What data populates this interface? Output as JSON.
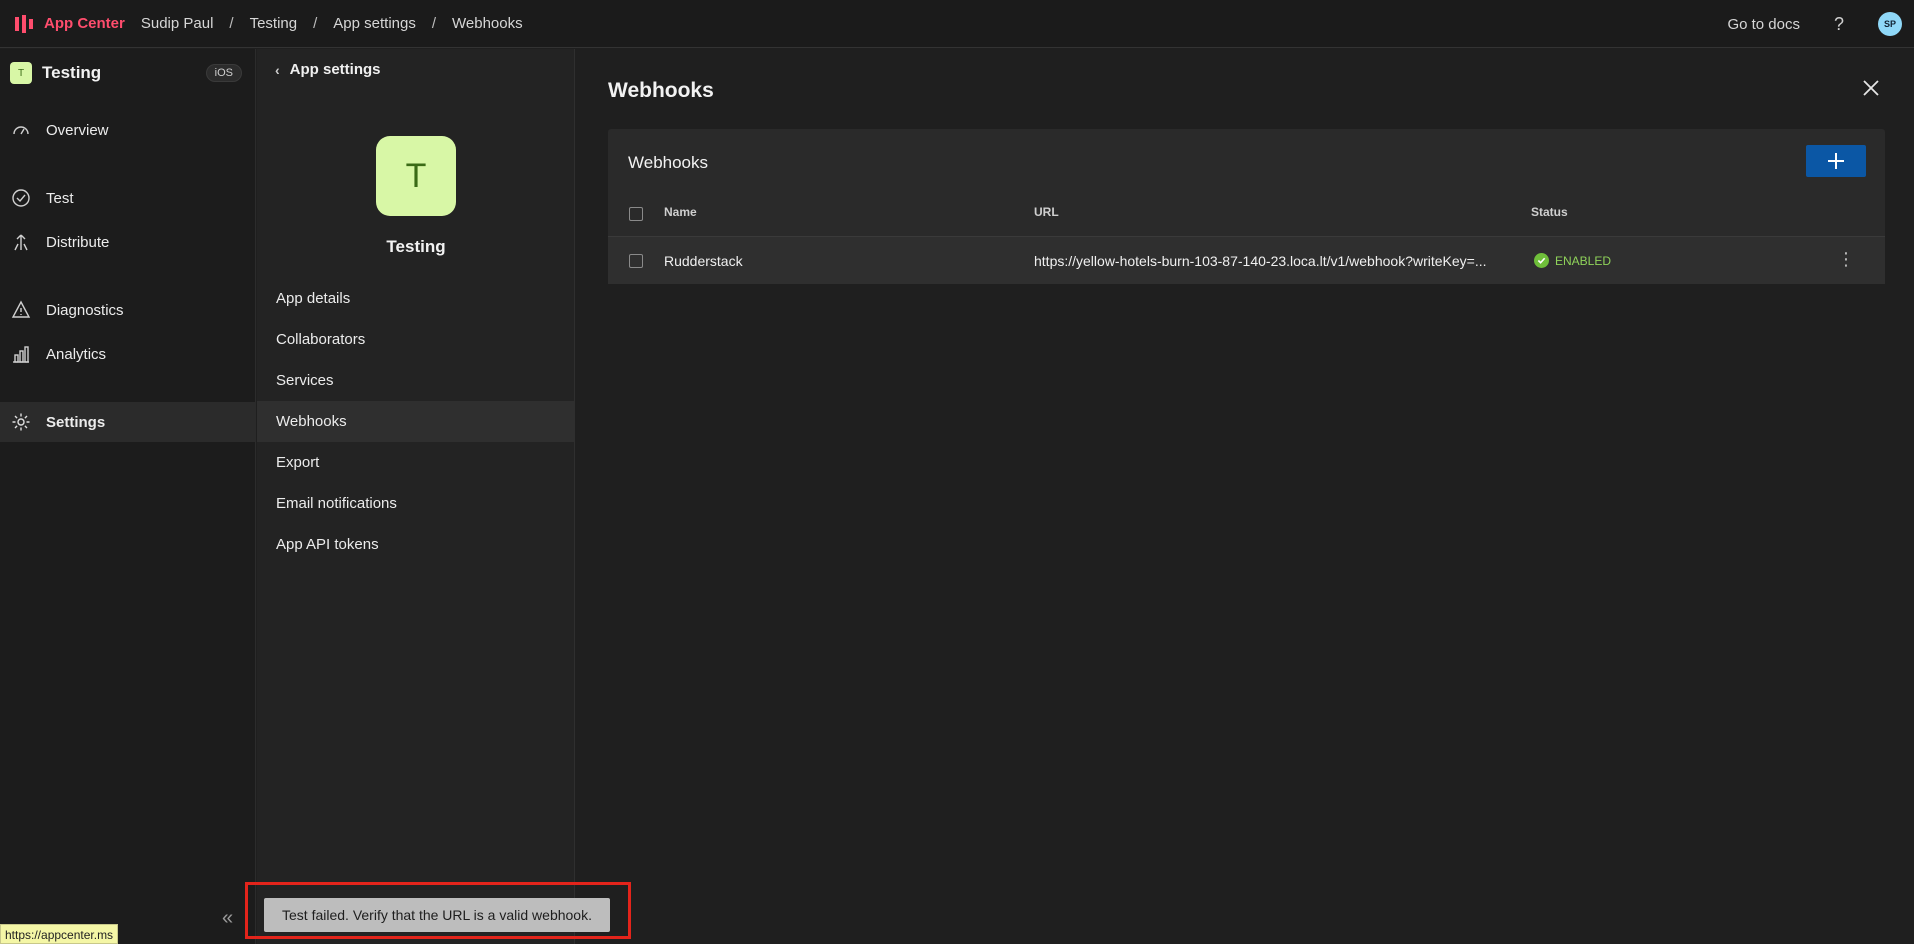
{
  "header": {
    "brand": "App Center",
    "breadcrumbs": [
      "Sudip Paul",
      "Testing",
      "App settings",
      "Webhooks"
    ],
    "docs_link": "Go to docs",
    "help": "?",
    "avatar_initials": "SP"
  },
  "left_nav": {
    "app_badge": "T",
    "app_name": "Testing",
    "platform": "iOS",
    "items": [
      {
        "label": "Overview",
        "icon": "gauge-icon"
      },
      {
        "label": "Test",
        "icon": "check-circle-icon"
      },
      {
        "label": "Distribute",
        "icon": "distribute-icon"
      },
      {
        "label": "Diagnostics",
        "icon": "warning-icon"
      },
      {
        "label": "Analytics",
        "icon": "bar-chart-icon"
      },
      {
        "label": "Settings",
        "icon": "gear-icon",
        "active": true
      }
    ],
    "collapse_icon": "double-chevron-left-icon"
  },
  "sub_nav": {
    "back_label": "App settings",
    "app_badge": "T",
    "app_name": "Testing",
    "items": [
      {
        "label": "App details"
      },
      {
        "label": "Collaborators"
      },
      {
        "label": "Services"
      },
      {
        "label": "Webhooks",
        "active": true
      },
      {
        "label": "Export"
      },
      {
        "label": "Email notifications"
      },
      {
        "label": "App API tokens"
      }
    ]
  },
  "main": {
    "title": "Webhooks",
    "card_title": "Webhooks",
    "columns": [
      "Name",
      "URL",
      "Status"
    ],
    "rows": [
      {
        "name": "Rudderstack",
        "url": "https://yellow-hotels-burn-103-87-140-23.loca.lt/v1/webhook?writeKey=...",
        "status": "ENABLED"
      }
    ]
  },
  "toast": {
    "message": "Test failed. Verify that the URL is a valid webhook."
  },
  "status_bar": {
    "url": "https://appcenter.ms"
  },
  "colors": {
    "brand": "#ff4d6d",
    "accent_button": "#0b57a5",
    "enabled": "#8fd35a",
    "toast_outline": "#e3241b"
  }
}
